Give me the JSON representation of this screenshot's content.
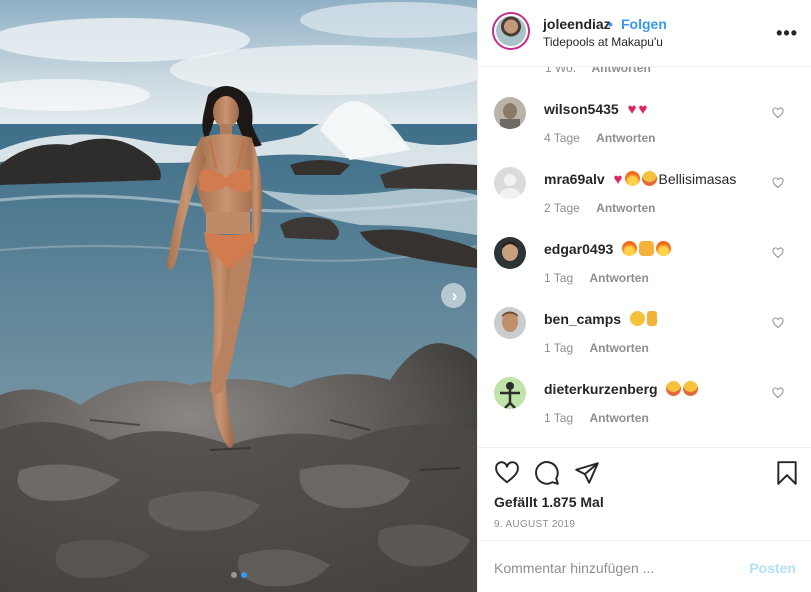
{
  "post": {
    "username": "joleendiaz",
    "separator": "•",
    "follow_label": "Folgen",
    "location": "Tidepools at Makapu'u",
    "more_icon": "more-options-icon",
    "photo_alt": "",
    "carousel": {
      "total": 2,
      "active_index": 1,
      "next_icon": "chevron-right-icon"
    }
  },
  "partial_comment": {
    "age": "1 Wo.",
    "reply_label": "Antworten"
  },
  "comments": [
    {
      "username": "wilson5435",
      "emojis": [
        "red-heart",
        "red-heart"
      ],
      "text": "",
      "age": "4 Tage",
      "reply_label": "Antworten"
    },
    {
      "username": "mra69alv",
      "emojis": [
        "red-heart",
        "fire",
        "star-struck"
      ],
      "text": "Bellisimasas",
      "age": "2 Tage",
      "reply_label": "Antworten"
    },
    {
      "username": "edgar0493",
      "emojis": [
        "fire",
        "raising-hands",
        "fire"
      ],
      "text": "",
      "age": "1 Tag",
      "reply_label": "Antworten"
    },
    {
      "username": "ben_camps",
      "emojis": [
        "smiling-face",
        "ok-hand"
      ],
      "text": "",
      "age": "1 Tag",
      "reply_label": "Antworten"
    },
    {
      "username": "dieterkurzenberg",
      "emojis": [
        "star-struck",
        "star-struck"
      ],
      "text": "",
      "age": "1 Tag",
      "reply_label": "Antworten"
    }
  ],
  "actions": {
    "like_icon": "heart-outline-icon",
    "comment_icon": "comment-bubble-icon",
    "share_icon": "paper-plane-icon",
    "save_icon": "bookmark-icon"
  },
  "likes_text": "Gefällt 1.875 Mal",
  "date_text": "9. AUGUST 2019",
  "add_comment": {
    "placeholder": "Kommentar hinzufügen ...",
    "value": "",
    "post_label": "Posten"
  },
  "colors": {
    "link_blue": "#3897f0",
    "post_disabled": "#b2dffc",
    "heart_red": "#e0245e",
    "muted_text": "#8e8e8e"
  }
}
